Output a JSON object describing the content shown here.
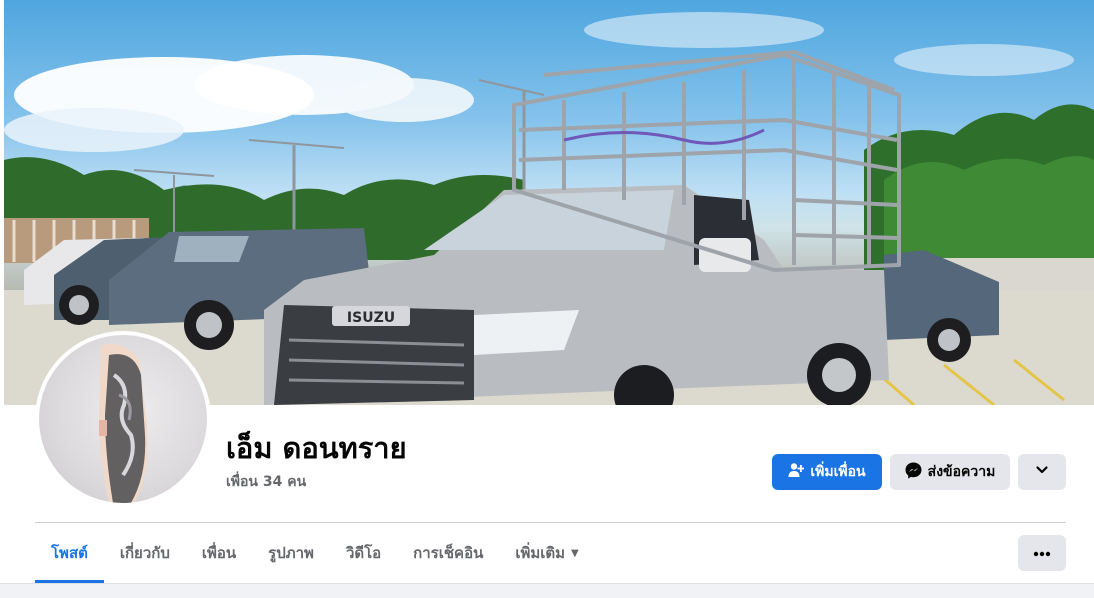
{
  "profile": {
    "name": "เอ็ม ดอนทราย",
    "friends_count": "เพื่อน 34 คน"
  },
  "cover": {
    "truck_badge": "ISUZU"
  },
  "actions": {
    "add_friend": "เพิ่มเพื่อน",
    "message": "ส่งข้อความ"
  },
  "tabs": [
    {
      "label": "โพสต์",
      "active": true
    },
    {
      "label": "เกี่ยวกับ",
      "active": false
    },
    {
      "label": "เพื่อน",
      "active": false
    },
    {
      "label": "รูปภาพ",
      "active": false
    },
    {
      "label": "วิดีโอ",
      "active": false
    },
    {
      "label": "การเช็คอิน",
      "active": false
    },
    {
      "label": "เพิ่มเติม",
      "active": false
    }
  ],
  "icons": {
    "add_friend": "person-plus-icon",
    "message": "messenger-icon",
    "more": "chevron-down-icon",
    "tab_more": "caret-down-icon",
    "overflow": "ellipsis-icon"
  },
  "colors": {
    "primary": "#1b74e4",
    "secondary_button": "#e4e6eb",
    "muted_text": "#65676b"
  }
}
